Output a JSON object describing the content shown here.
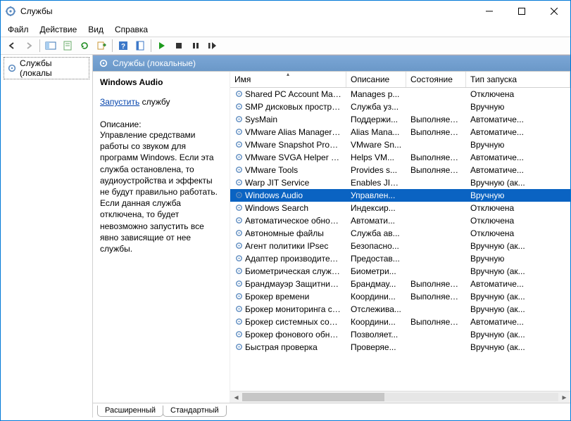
{
  "window": {
    "title": "Службы"
  },
  "menu": {
    "items": [
      "Файл",
      "Действие",
      "Вид",
      "Справка"
    ]
  },
  "tree": {
    "node": "Службы (локалы"
  },
  "header": {
    "title": "Службы (локальные)"
  },
  "detail": {
    "title": "Windows Audio",
    "action_link": "Запустить",
    "action_suffix": " службу",
    "desc_label": "Описание:",
    "desc_text": "Управление средствами работы со звуком для программ Windows. Если эта служба остановлена, то аудиоустройства и эффекты не будут правильно работать.  Если данная служба отключена, то будет невозможно запустить все явно зависящие от нее службы."
  },
  "columns": {
    "name": "Имя",
    "desc": "Описание",
    "state": "Состояние",
    "start": "Тип запуска"
  },
  "rows": [
    {
      "name": "Shared PC Account Manager",
      "desc": "Manages p...",
      "state": "",
      "start": "Отключена"
    },
    {
      "name": "SMP дисковых пространст...",
      "desc": "Служба уз...",
      "state": "",
      "start": "Вручную"
    },
    {
      "name": "SysMain",
      "desc": "Поддержи...",
      "state": "Выполняется",
      "start": "Автоматиче..."
    },
    {
      "name": "VMware Alias Manager and ...",
      "desc": "Alias Mana...",
      "state": "Выполняется",
      "start": "Автоматиче..."
    },
    {
      "name": "VMware Snapshot Provider",
      "desc": "VMware Sn...",
      "state": "",
      "start": "Вручную"
    },
    {
      "name": "VMware SVGA Helper Service",
      "desc": "Helps VM...",
      "state": "Выполняется",
      "start": "Автоматиче..."
    },
    {
      "name": "VMware Tools",
      "desc": "Provides s...",
      "state": "Выполняется",
      "start": "Автоматиче..."
    },
    {
      "name": "Warp JIT Service",
      "desc": "Enables JIT ...",
      "state": "",
      "start": "Вручную (ак..."
    },
    {
      "name": "Windows Audio",
      "desc": "Управлен...",
      "state": "",
      "start": "Вручную",
      "selected": true
    },
    {
      "name": "Windows Search",
      "desc": "Индексир...",
      "state": "",
      "start": "Отключена"
    },
    {
      "name": "Автоматическое обновле...",
      "desc": "Автомати...",
      "state": "",
      "start": "Отключена"
    },
    {
      "name": "Автономные файлы",
      "desc": "Служба ав...",
      "state": "",
      "start": "Отключена"
    },
    {
      "name": "Агент политики IPsec",
      "desc": "Безопасно...",
      "state": "",
      "start": "Вручную (ак..."
    },
    {
      "name": "Адаптер производительно...",
      "desc": "Предостав...",
      "state": "",
      "start": "Вручную"
    },
    {
      "name": "Биометрическая служба ...",
      "desc": "Биометри...",
      "state": "",
      "start": "Вручную (ак..."
    },
    {
      "name": "Брандмауэр Защитника W...",
      "desc": "Брандмау...",
      "state": "Выполняется",
      "start": "Автоматиче..."
    },
    {
      "name": "Брокер времени",
      "desc": "Координи...",
      "state": "Выполняется",
      "start": "Вручную (ак..."
    },
    {
      "name": "Брокер мониторинга сред...",
      "desc": "Отслежива...",
      "state": "",
      "start": "Вручную (ак..."
    },
    {
      "name": "Брокер системных событий",
      "desc": "Координи...",
      "state": "Выполняется",
      "start": "Автоматиче..."
    },
    {
      "name": "Брокер фонового обнару...",
      "desc": "Позволяет...",
      "state": "",
      "start": "Вручную (ак..."
    },
    {
      "name": "Быстрая проверка",
      "desc": "Проверяе...",
      "state": "",
      "start": "Вручную (ак..."
    }
  ],
  "tabs": {
    "items": [
      "Расширенный",
      "Стандартный"
    ],
    "active": 0
  }
}
